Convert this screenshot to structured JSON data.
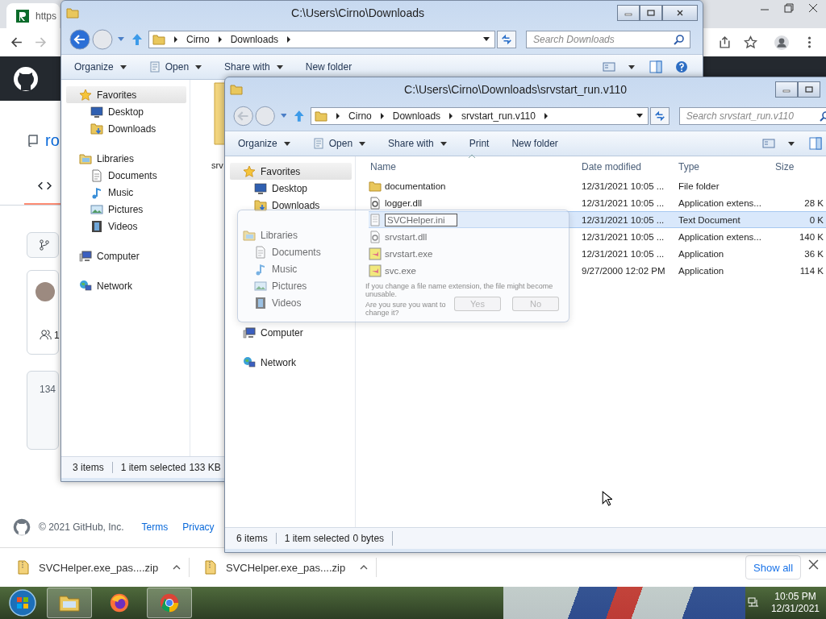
{
  "browser": {
    "tabs": [
      {
        "title": "https",
        "selected": true
      }
    ],
    "github": {
      "repo": "ro",
      "people_count": "1",
      "commits": "134",
      "copyright": "© 2021 GitHub, Inc.",
      "footer_links": [
        "Terms",
        "Privacy"
      ]
    },
    "downloads": [
      {
        "name": "SVCHelper.exe_pas....zip"
      },
      {
        "name": "SVCHelper.exe_pas....zip"
      }
    ],
    "show_all": "Show all"
  },
  "windows": [
    {
      "title": "C:\\Users\\Cirno\\Downloads",
      "back_enabled": true,
      "help_button": true,
      "path": [
        "Cirno",
        "Downloads"
      ],
      "search_placeholder": "Search Downloads",
      "toolbar": [
        {
          "label": "Organize",
          "dropdown": true,
          "icon": false
        },
        {
          "label": "Open",
          "dropdown": true,
          "icon": true
        },
        {
          "label": "Share with",
          "dropdown": true,
          "icon": false
        },
        {
          "label": "New folder",
          "dropdown": false,
          "icon": false
        }
      ],
      "nav": [
        {
          "label": "Favorites",
          "kind": "star",
          "selected": true,
          "children": [
            {
              "label": "Desktop",
              "kind": "desktop"
            },
            {
              "label": "Downloads",
              "kind": "downloads"
            }
          ]
        },
        {
          "label": "Libraries",
          "kind": "libraries",
          "selected": false,
          "children": [
            {
              "label": "Documents",
              "kind": "documents"
            },
            {
              "label": "Music",
              "kind": "music"
            },
            {
              "label": "Pictures",
              "kind": "pictures"
            },
            {
              "label": "Videos",
              "kind": "videos"
            }
          ]
        },
        {
          "label": "Computer",
          "kind": "computer",
          "selected": false
        },
        {
          "label": "Network",
          "kind": "network",
          "selected": false
        }
      ],
      "items": [
        {
          "name": "srv"
        }
      ],
      "status": {
        "count": "3 items",
        "selection": "1 item selected",
        "size": "133 KB"
      }
    },
    {
      "title": "C:\\Users\\Cirno\\Downloads\\srvstart_run.v110",
      "back_enabled": false,
      "help_button": false,
      "path": [
        "Cirno",
        "Downloads",
        "srvstart_run.v110"
      ],
      "search_placeholder": "Search srvstart_run.v110",
      "toolbar": [
        {
          "label": "Organize",
          "dropdown": true,
          "icon": false
        },
        {
          "label": "Open",
          "dropdown": true,
          "icon": true
        },
        {
          "label": "Share with",
          "dropdown": true,
          "icon": false
        },
        {
          "label": "Print",
          "dropdown": false,
          "icon": false
        },
        {
          "label": "New folder",
          "dropdown": false,
          "icon": false
        }
      ],
      "nav": [
        {
          "label": "Favorites",
          "kind": "star",
          "selected": true,
          "children": [
            {
              "label": "Desktop",
              "kind": "desktop"
            },
            {
              "label": "Downloads",
              "kind": "downloads"
            }
          ]
        },
        {
          "label": "Libraries",
          "kind": "libraries",
          "selected": false,
          "children": [
            {
              "label": "Documents",
              "kind": "documents"
            },
            {
              "label": "Music",
              "kind": "music"
            },
            {
              "label": "Pictures",
              "kind": "pictures"
            },
            {
              "label": "Videos",
              "kind": "videos"
            }
          ]
        },
        {
          "label": "Computer",
          "kind": "computer",
          "selected": false
        },
        {
          "label": "Network",
          "kind": "network",
          "selected": false
        }
      ],
      "columns": [
        "Name",
        "Date modified",
        "Type",
        "Size"
      ],
      "items": [
        {
          "name": "documentation",
          "kind": "folder",
          "date": "12/31/2021 10:05 ...",
          "type": "File folder",
          "selected": false,
          "renaming": false
        },
        {
          "name": "logger.dll",
          "kind": "dll",
          "date": "12/31/2021 10:05 ...",
          "type": "Application extens...",
          "size": "28 K",
          "selected": false,
          "renaming": false
        },
        {
          "name": "SVCHelper.ini",
          "kind": "text",
          "date": "12/31/2021 10:05 ...",
          "type": "Text Document",
          "size": "0 K",
          "selected": true,
          "renaming": true
        },
        {
          "name": "srvstart.dll",
          "kind": "dll",
          "date": "12/31/2021 10:05 ...",
          "type": "Application extens...",
          "size": "140 K",
          "selected": false,
          "renaming": false
        },
        {
          "name": "srvstart.exe",
          "kind": "app",
          "date": "12/31/2021 10:05 ...",
          "type": "Application",
          "size": "36 K",
          "selected": false,
          "renaming": false
        },
        {
          "name": "svc.exe",
          "kind": "app",
          "date": "9/27/2000 12:02 PM",
          "type": "Application",
          "size": "114 K",
          "selected": false,
          "renaming": false
        }
      ],
      "status": {
        "count": "6 items",
        "selection": "1 item selected",
        "size": "0 bytes"
      }
    }
  ],
  "dialog": {
    "message": "If you change a file name extension, the file might become unusable.",
    "question": "Are you sure you want to change it?",
    "buttons": [
      "Yes",
      "No"
    ]
  },
  "taskbar": {
    "apps": [
      {
        "kind": "explorer",
        "active": true
      },
      {
        "kind": "firefox",
        "active": false
      },
      {
        "kind": "chrome",
        "active": true
      }
    ],
    "time": "10:05 PM",
    "date": "12/31/2021"
  }
}
